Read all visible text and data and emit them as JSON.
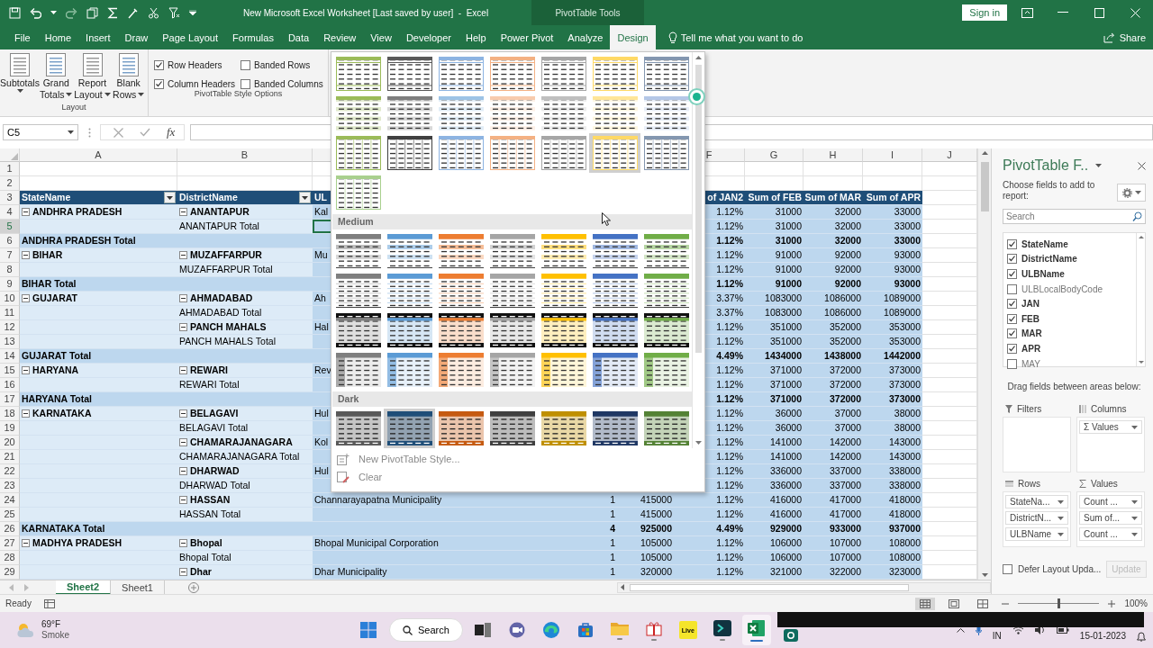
{
  "title_bar": {
    "title": "New Microsoft Excel Worksheet [Last saved by user]  -  Excel",
    "context_label": "PivotTable Tools",
    "sign_in": "Sign in"
  },
  "ribbon_tabs": [
    {
      "label": "File",
      "selected": false
    },
    {
      "label": "Home",
      "selected": false
    },
    {
      "label": "Insert",
      "selected": false
    },
    {
      "label": "Draw",
      "selected": false
    },
    {
      "label": "Page Layout",
      "selected": false
    },
    {
      "label": "Formulas",
      "selected": false
    },
    {
      "label": "Data",
      "selected": false
    },
    {
      "label": "Review",
      "selected": false
    },
    {
      "label": "View",
      "selected": false
    },
    {
      "label": "Developer",
      "selected": false
    },
    {
      "label": "Help",
      "selected": false
    },
    {
      "label": "Power Pivot",
      "selected": false
    },
    {
      "label": "Analyze",
      "selected": false
    },
    {
      "label": "Design",
      "selected": true
    }
  ],
  "tell_me": "Tell me what you want to do",
  "share": "Share",
  "ribbon_groups": [
    {
      "kind": "buttons",
      "title": "Layout",
      "items": [
        {
          "lines": [
            "Subtotals"
          ]
        },
        {
          "lines": [
            "Grand",
            "Totals"
          ]
        },
        {
          "lines": [
            "Report",
            "Layout"
          ]
        },
        {
          "lines": [
            "Blank",
            "Rows"
          ]
        }
      ]
    },
    {
      "kind": "checks",
      "title": "PivotTable Style Options",
      "items": [
        {
          "label": "Row Headers",
          "checked": true
        },
        {
          "label": "Banded Rows",
          "checked": false
        },
        {
          "label": "Column Headers",
          "checked": true
        },
        {
          "label": "Banded Columns",
          "checked": false
        }
      ]
    }
  ],
  "formula_bar": {
    "name_box": "C5",
    "fx": "fx"
  },
  "grid": {
    "column_letters": [
      "A",
      "B",
      "F",
      "G",
      "H",
      "I",
      "J"
    ],
    "rows": [
      {
        "num": "1",
        "kind": "blank",
        "selected": false
      },
      {
        "num": "2",
        "kind": "blank",
        "selected": false
      },
      {
        "num": "3",
        "kind": "header",
        "selected": false,
        "cells": {
          "a": "StateName",
          "b": "DistrictName",
          "c": "UL",
          "f": "of JAN2",
          "g": "Sum of FEB",
          "h": "Sum of MAR",
          "i": "Sum of APR"
        }
      },
      {
        "num": "4",
        "kind": "item",
        "selected": false,
        "cells": {
          "a": "ANDHRA PRADESH",
          "b": "ANANTAPUR",
          "c": "Kal",
          "f": "1.12%",
          "g": "31000",
          "h": "32000",
          "i": "33000"
        }
      },
      {
        "num": "5",
        "kind": "subtotal",
        "selected": true,
        "cells": {
          "b": "ANANTAPUR Total",
          "f": "1.12%",
          "g": "31000",
          "h": "32000",
          "i": "33000"
        }
      },
      {
        "num": "6",
        "kind": "total",
        "selected": false,
        "cells": {
          "a": "ANDHRA PRADESH Total",
          "f": "1.12%",
          "g": "31000",
          "h": "32000",
          "i": "33000"
        }
      },
      {
        "num": "7",
        "kind": "item",
        "selected": false,
        "cells": {
          "a": "BIHAR",
          "b": "MUZAFFARPUR",
          "c": "Mu",
          "f": "1.12%",
          "g": "91000",
          "h": "92000",
          "i": "93000"
        }
      },
      {
        "num": "8",
        "kind": "subtotal",
        "selected": false,
        "cells": {
          "b": "MUZAFFARPUR Total",
          "f": "1.12%",
          "g": "91000",
          "h": "92000",
          "i": "93000"
        }
      },
      {
        "num": "9",
        "kind": "total",
        "selected": false,
        "cells": {
          "a": "BIHAR Total",
          "f": "1.12%",
          "g": "91000",
          "h": "92000",
          "i": "93000"
        }
      },
      {
        "num": "10",
        "kind": "item",
        "selected": false,
        "cells": {
          "a": "GUJARAT",
          "b": "AHMADABAD",
          "c": "Ah",
          "f": "3.37%",
          "g": "1083000",
          "h": "1086000",
          "i": "1089000"
        }
      },
      {
        "num": "11",
        "kind": "subtotal",
        "selected": false,
        "cells": {
          "b": "AHMADABAD Total",
          "f": "3.37%",
          "g": "1083000",
          "h": "1086000",
          "i": "1089000"
        }
      },
      {
        "num": "12",
        "kind": "item",
        "selected": false,
        "cells": {
          "b": "PANCH MAHALS",
          "c": "Hal",
          "f": "1.12%",
          "g": "351000",
          "h": "352000",
          "i": "353000"
        }
      },
      {
        "num": "13",
        "kind": "subtotal",
        "selected": false,
        "cells": {
          "b": "PANCH MAHALS Total",
          "f": "1.12%",
          "g": "351000",
          "h": "352000",
          "i": "353000"
        }
      },
      {
        "num": "14",
        "kind": "total",
        "selected": false,
        "cells": {
          "a": "GUJARAT Total",
          "f": "4.49%",
          "g": "1434000",
          "h": "1438000",
          "i": "1442000"
        }
      },
      {
        "num": "15",
        "kind": "item",
        "selected": false,
        "cells": {
          "a": "HARYANA",
          "b": "REWARI",
          "c": "Rev",
          "f": "1.12%",
          "g": "371000",
          "h": "372000",
          "i": "373000"
        }
      },
      {
        "num": "16",
        "kind": "subtotal",
        "selected": false,
        "cells": {
          "b": "REWARI Total",
          "f": "1.12%",
          "g": "371000",
          "h": "372000",
          "i": "373000"
        }
      },
      {
        "num": "17",
        "kind": "total",
        "selected": false,
        "cells": {
          "a": "HARYANA Total",
          "f": "1.12%",
          "g": "371000",
          "h": "372000",
          "i": "373000"
        }
      },
      {
        "num": "18",
        "kind": "item",
        "selected": false,
        "cells": {
          "a": "KARNATAKA",
          "b": "BELAGAVI",
          "c": "Hul",
          "f": "1.12%",
          "g": "36000",
          "h": "37000",
          "i": "38000"
        }
      },
      {
        "num": "19",
        "kind": "subtotal",
        "selected": false,
        "cells": {
          "b": "BELAGAVI Total",
          "f": "1.12%",
          "g": "36000",
          "h": "37000",
          "i": "38000"
        }
      },
      {
        "num": "20",
        "kind": "item",
        "selected": false,
        "cells": {
          "b": "CHAMARAJANAGARA",
          "c": "Kol",
          "f": "1.12%",
          "g": "141000",
          "h": "142000",
          "i": "143000"
        }
      },
      {
        "num": "21",
        "kind": "subtotal",
        "selected": false,
        "cells": {
          "b": "CHAMARAJANAGARA Total",
          "f": "1.12%",
          "g": "141000",
          "h": "142000",
          "i": "143000"
        }
      },
      {
        "num": "22",
        "kind": "item",
        "selected": false,
        "cells": {
          "b": "DHARWAD",
          "c": "Hul",
          "f": "1.12%",
          "g": "336000",
          "h": "337000",
          "i": "338000"
        }
      },
      {
        "num": "23",
        "kind": "subtotal",
        "selected": false,
        "cells": {
          "b": "DHARWAD Total",
          "f": "1.12%",
          "g": "336000",
          "h": "337000",
          "i": "338000"
        }
      },
      {
        "num": "24",
        "kind": "item",
        "selected": false,
        "cells": {
          "b": "HASSAN",
          "c": "Channarayapatna Municipality",
          "d": "1",
          "e": "415000",
          "f": "1.12%",
          "g": "416000",
          "h": "417000",
          "i": "418000"
        }
      },
      {
        "num": "25",
        "kind": "subtotal",
        "selected": false,
        "cells": {
          "b": "HASSAN Total",
          "d": "1",
          "e": "415000",
          "f": "1.12%",
          "g": "416000",
          "h": "417000",
          "i": "418000"
        }
      },
      {
        "num": "26",
        "kind": "total",
        "selected": false,
        "cells": {
          "a": "KARNATAKA Total",
          "d": "4",
          "e": "925000",
          "f": "4.49%",
          "g": "929000",
          "h": "933000",
          "i": "937000"
        }
      },
      {
        "num": "27",
        "kind": "item",
        "selected": false,
        "cells": {
          "a": "MADHYA PRADESH",
          "b": "Bhopal",
          "c": "Bhopal Municipal Corporation",
          "d": "1",
          "e": "105000",
          "f": "1.12%",
          "g": "106000",
          "h": "107000",
          "i": "108000"
        }
      },
      {
        "num": "28",
        "kind": "subtotal",
        "selected": false,
        "cells": {
          "b": "Bhopal Total",
          "d": "1",
          "e": "105000",
          "f": "1.12%",
          "g": "106000",
          "h": "107000",
          "i": "108000"
        }
      },
      {
        "num": "29",
        "kind": "item",
        "selected": false,
        "cells": {
          "b": "Dhar",
          "c": "Dhar Municipality",
          "d": "1",
          "e": "320000",
          "f": "1.12%",
          "g": "321000",
          "h": "322000",
          "i": "323000"
        }
      }
    ]
  },
  "sheet_tabs": [
    {
      "label": "Sheet2",
      "selected": true
    },
    {
      "label": "Sheet1",
      "selected": false
    }
  ],
  "gallery": {
    "sections": [
      {
        "kind": "light",
        "thumbnails": [
          {
            "color": "#9bbb59",
            "selected": false
          },
          {
            "color": "#595959",
            "selected": false
          },
          {
            "color": "#8db4e2",
            "selected": false
          },
          {
            "color": "#f4b183",
            "selected": false
          },
          {
            "color": "#a6a6a6",
            "selected": false
          },
          {
            "color": "#ffd966",
            "selected": false
          },
          {
            "color": "#8497b0",
            "selected": false
          },
          {
            "color": "#9bbb59",
            "selected": false
          },
          {
            "color": "#7f7f7f",
            "selected": false
          },
          {
            "color": "#9dc3e6",
            "selected": false
          },
          {
            "color": "#f8cbad",
            "selected": false
          },
          {
            "color": "#bfbfbf",
            "selected": false
          },
          {
            "color": "#ffe699",
            "selected": false
          },
          {
            "color": "#b4c7e7",
            "selected": false
          },
          {
            "color": "#9bbb59",
            "selected": false
          },
          {
            "color": "#404040",
            "selected": false
          },
          {
            "color": "#8db4e2",
            "selected": false
          },
          {
            "color": "#f4b183",
            "selected": false
          },
          {
            "color": "#a6a6a6",
            "selected": false
          },
          {
            "color": "#ffd966",
            "selected": true
          },
          {
            "color": "#8497b0",
            "selected": false
          },
          {
            "color": "#a9d08e",
            "selected": false
          }
        ]
      },
      {
        "kind": "medium",
        "title": "Medium",
        "thumbnails": [
          {
            "color": "#7f7f7f",
            "selected": false
          },
          {
            "color": "#5b9bd5",
            "selected": false
          },
          {
            "color": "#ed7d31",
            "selected": false
          },
          {
            "color": "#a5a5a5",
            "selected": false
          },
          {
            "color": "#ffc000",
            "selected": false
          },
          {
            "color": "#4472c4",
            "selected": false
          },
          {
            "color": "#70ad47",
            "selected": false
          },
          {
            "color": "#7f7f7f",
            "selected": false
          },
          {
            "color": "#5b9bd5",
            "selected": false
          },
          {
            "color": "#ed7d31",
            "selected": false
          },
          {
            "color": "#a5a5a5",
            "selected": false
          },
          {
            "color": "#ffc000",
            "selected": false
          },
          {
            "color": "#4472c4",
            "selected": false
          },
          {
            "color": "#70ad47",
            "selected": false
          },
          {
            "color": "#7f7f7f",
            "selected": false
          },
          {
            "color": "#5b9bd5",
            "selected": false
          },
          {
            "color": "#ed7d31",
            "selected": false
          },
          {
            "color": "#a5a5a5",
            "selected": false
          },
          {
            "color": "#ffc000",
            "selected": false
          },
          {
            "color": "#4472c4",
            "selected": false
          },
          {
            "color": "#70ad47",
            "selected": false
          },
          {
            "color": "#7f7f7f",
            "selected": false
          },
          {
            "color": "#5b9bd5",
            "selected": false
          },
          {
            "color": "#ed7d31",
            "selected": false
          },
          {
            "color": "#a5a5a5",
            "selected": false
          },
          {
            "color": "#ffc000",
            "selected": false
          },
          {
            "color": "#4472c4",
            "selected": false
          },
          {
            "color": "#70ad47",
            "selected": false
          }
        ]
      },
      {
        "kind": "dark",
        "title": "Dark",
        "thumbnails": [
          {
            "color": "#595959",
            "selected": false
          },
          {
            "color": "#1f4e78",
            "selected": true
          },
          {
            "color": "#c55a11",
            "selected": false
          },
          {
            "color": "#404040",
            "selected": false
          },
          {
            "color": "#bf8f00",
            "selected": false
          },
          {
            "color": "#203864",
            "selected": false
          },
          {
            "color": "#548235",
            "selected": false
          }
        ]
      }
    ],
    "menu": [
      {
        "kind": "new",
        "label": "New PivotTable Style..."
      },
      {
        "kind": "clear",
        "label": "Clear"
      }
    ]
  },
  "pivot_pane": {
    "title": "PivotTable F..",
    "instructions": "Choose fields to add to report:",
    "search_placeholder": "Search",
    "fields": [
      {
        "label": "StateName",
        "checked": true
      },
      {
        "label": "DistrictName",
        "checked": true
      },
      {
        "label": "ULBName",
        "checked": true
      },
      {
        "label": "ULBLocalBodyCode",
        "checked": false
      },
      {
        "label": "JAN",
        "checked": true
      },
      {
        "label": "FEB",
        "checked": true
      },
      {
        "label": "MAR",
        "checked": true
      },
      {
        "label": "APR",
        "checked": true
      },
      {
        "label": "MAY",
        "checked": false
      }
    ],
    "drag_hint": "Drag fields between areas below:",
    "areas": [
      {
        "kind": "filters",
        "title": "Filters"
      },
      {
        "kind": "columns",
        "title": "Columns",
        "items": [
          "Σ Values"
        ]
      },
      {
        "kind": "rows",
        "title": "Rows",
        "items": [
          "StateNa...",
          "DistrictN...",
          "ULBName"
        ]
      },
      {
        "kind": "values",
        "title": "Values",
        "items": [
          "Count ...",
          "Sum of...",
          "Count ..."
        ]
      }
    ],
    "defer": {
      "label": "Defer Layout Upda...",
      "checked": false
    },
    "update": {
      "label": "Update",
      "disabled": true
    }
  },
  "status_bar": {
    "text": "Ready",
    "zoom": "100%",
    "zoom_slider": {
      "level": 0.5
    }
  },
  "taskbar": {
    "weather": {
      "temp": "69°F",
      "condition": "Smoke"
    },
    "search": "Search",
    "apps": [
      {
        "kind": "taskview",
        "active": false,
        "running": false
      },
      {
        "kind": "chat",
        "active": false,
        "running": false
      },
      {
        "kind": "browser",
        "active": false,
        "running": false
      },
      {
        "kind": "store",
        "active": false,
        "running": false
      },
      {
        "kind": "folder",
        "active": false,
        "running": true
      },
      {
        "kind": "gift",
        "active": false,
        "running": true
      },
      {
        "kind": "live",
        "label": "Live",
        "active": false,
        "running": false
      },
      {
        "kind": "terminal",
        "active": false,
        "running": true
      },
      {
        "kind": "sheet",
        "active": true,
        "running": true
      },
      {
        "kind": "camera",
        "active": false,
        "running": false
      }
    ],
    "region": "IN",
    "date": "15-01-2023"
  }
}
